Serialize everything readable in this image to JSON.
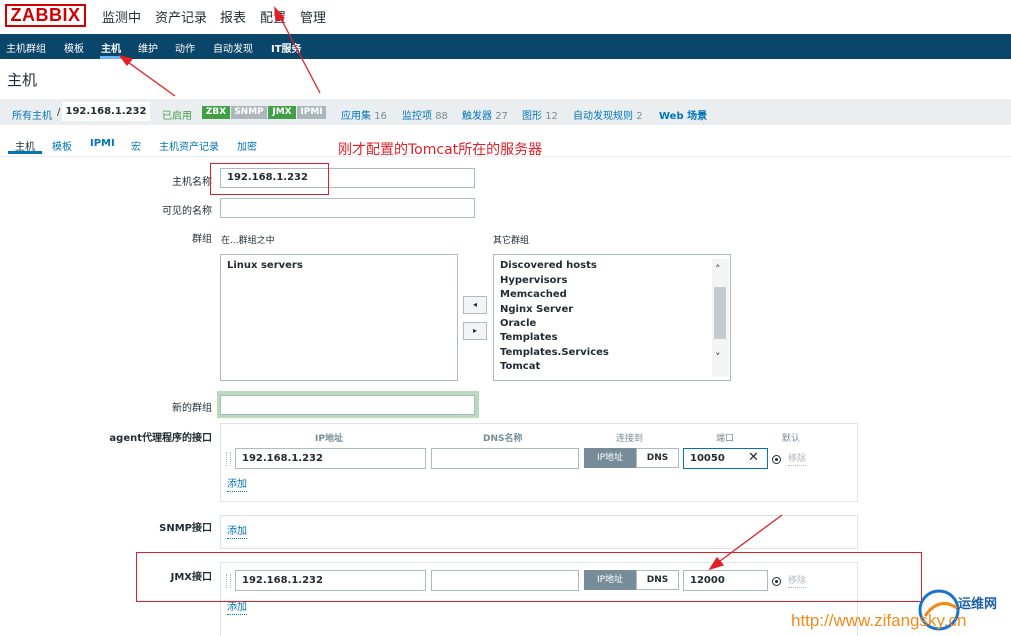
{
  "app": {
    "logo": "ZABBIX"
  },
  "top_menu": [
    {
      "label": "监测中"
    },
    {
      "label": "资产记录"
    },
    {
      "label": "报表"
    },
    {
      "label": "配置"
    },
    {
      "label": "管理"
    }
  ],
  "sub_menu": [
    {
      "label": "主机群组"
    },
    {
      "label": "模板"
    },
    {
      "label": "主机"
    },
    {
      "label": "维护"
    },
    {
      "label": "动作"
    },
    {
      "label": "自动发现"
    },
    {
      "label": "IT服务"
    }
  ],
  "page_title": "主机",
  "breadcrumb": {
    "all_hosts": "所有主机",
    "separator": "/",
    "host": "192.168.1.232",
    "status": "已启用",
    "tags": [
      "ZBX",
      "SNMP",
      "JMX",
      "IPMI"
    ],
    "links": [
      {
        "label": "应用集",
        "count": "16"
      },
      {
        "label": "监控项",
        "count": "88"
      },
      {
        "label": "触发器",
        "count": "27"
      },
      {
        "label": "图形",
        "count": "12"
      },
      {
        "label": "自动发现规则",
        "count": "2"
      },
      {
        "label": "Web 场景",
        "count": ""
      }
    ]
  },
  "tabs": [
    {
      "label": "主机"
    },
    {
      "label": "模板"
    },
    {
      "label": "IPMI"
    },
    {
      "label": "宏"
    },
    {
      "label": "主机资产记录"
    },
    {
      "label": "加密"
    }
  ],
  "form": {
    "host_name_label": "主机名称",
    "host_name_value": "192.168.1.232",
    "visible_name_label": "可见的名称",
    "visible_name_value": "",
    "groups_label": "群组",
    "in_groups_label": "在...群组之中",
    "other_groups_label": "其它群组",
    "in_groups": [
      "Linux servers"
    ],
    "other_groups": [
      "Discovered hosts",
      "Hypervisors",
      "Memcached",
      "Nginx Server",
      "Oracle",
      "Templates",
      "Templates.Services",
      "Tomcat"
    ],
    "move_left": "◂",
    "move_right": "▸",
    "new_group_label": "新的群组",
    "new_group_value": "",
    "agent_label": "agent代理程序的接口",
    "col_ip": "IP地址",
    "col_dns": "DNS名称",
    "col_connect": "连接到",
    "col_port": "端口",
    "col_default": "默认",
    "agent": {
      "ip": "192.168.1.232",
      "dns": "",
      "port": "10050"
    },
    "connect_ip": "IP地址",
    "connect_dns": "DNS",
    "remove": "移除",
    "add": "添加",
    "snmp_label": "SNMP接口",
    "jmx_label": "JMX接口",
    "jmx": {
      "ip": "192.168.1.232",
      "dns": "",
      "port": "12000"
    }
  },
  "annotation": "刚才配置的Tomcat所在的服务器",
  "watermark": {
    "brand": "运维网",
    "url": "http://www.zifangsky.cn"
  },
  "colors": {
    "header": "#0a466a",
    "brand_red": "#d40000",
    "link": "#0275b8",
    "green": "#429e47",
    "annotation": "#e21f26"
  }
}
